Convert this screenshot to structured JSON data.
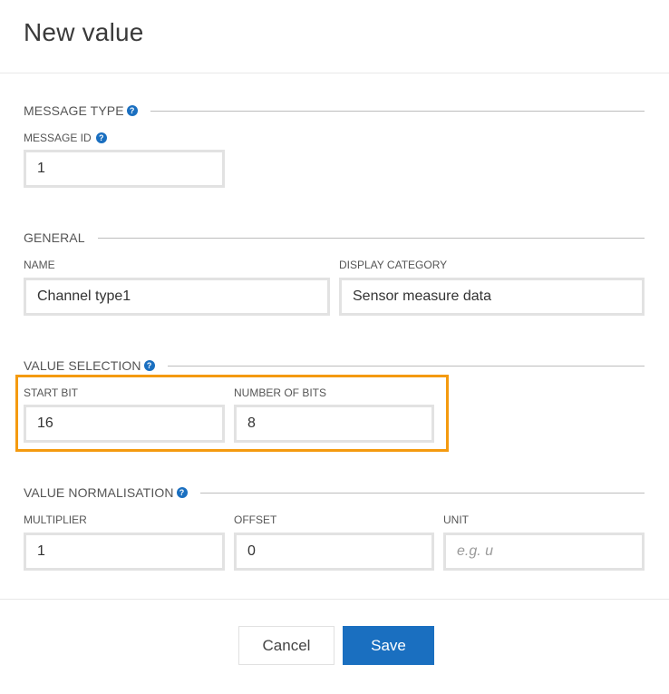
{
  "dialog": {
    "title": "New value"
  },
  "sections": {
    "message_type": {
      "title": "MESSAGE TYPE",
      "fields": {
        "message_id": {
          "label": "MESSAGE ID",
          "value": "1"
        }
      }
    },
    "general": {
      "title": "GENERAL",
      "fields": {
        "name": {
          "label": "NAME",
          "value": "Channel type1"
        },
        "display_category": {
          "label": "DISPLAY CATEGORY",
          "value": "Sensor measure data"
        }
      }
    },
    "value_selection": {
      "title": "VALUE SELECTION",
      "fields": {
        "start_bit": {
          "label": "START BIT",
          "value": "16"
        },
        "number_of_bits": {
          "label": "NUMBER OF BITS",
          "value": "8"
        }
      }
    },
    "value_normalisation": {
      "title": "VALUE NORMALISATION",
      "fields": {
        "multiplier": {
          "label": "MULTIPLIER",
          "value": "1"
        },
        "offset": {
          "label": "OFFSET",
          "value": "0"
        },
        "unit": {
          "label": "UNIT",
          "value": "",
          "placeholder": "e.g. u"
        }
      }
    }
  },
  "buttons": {
    "cancel": "Cancel",
    "save": "Save"
  },
  "icons": {
    "help": "help-icon",
    "help_glyph": "?"
  },
  "colors": {
    "accent": "#1a6fc0",
    "highlight": "#f49a0f",
    "input_border": "#e2e2e2"
  }
}
